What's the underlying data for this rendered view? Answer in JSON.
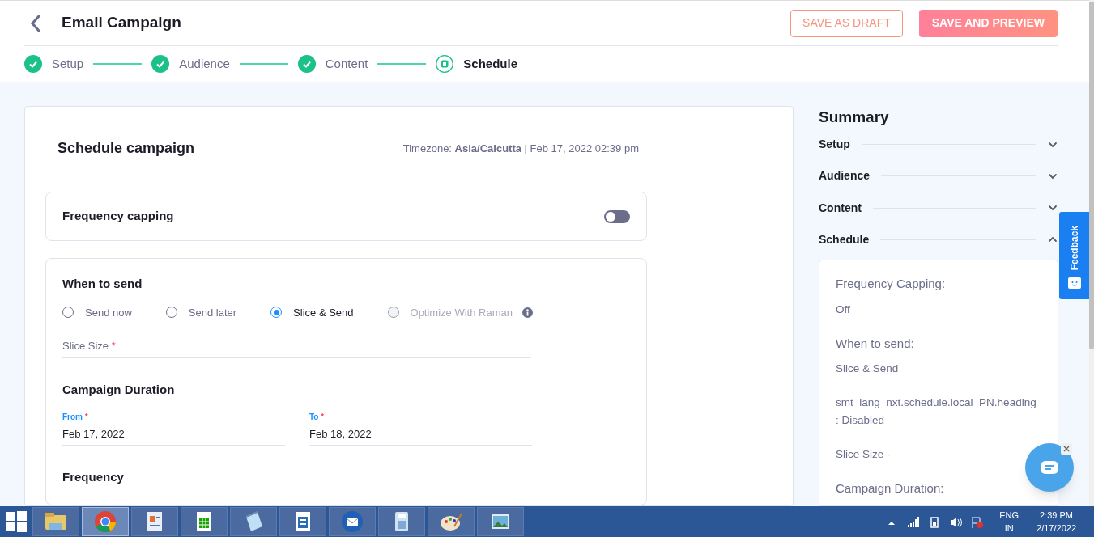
{
  "header": {
    "title": "Email Campaign",
    "buttons": [
      {
        "label": "SAVE AS DRAFT",
        "kind": "outline"
      },
      {
        "label": "SAVE AND PREVIEW",
        "kind": "filled"
      }
    ]
  },
  "steps": [
    {
      "label": "Setup",
      "completed": true
    },
    {
      "label": "Audience",
      "completed": true
    },
    {
      "label": "Content",
      "completed": true
    },
    {
      "label": "Schedule",
      "completed": false
    }
  ],
  "schedule": {
    "title": "Schedule campaign",
    "timezone_label": "Timezone:",
    "timezone": "Asia/Calcutta",
    "datetime": "| Feb 17, 2022 02:39 pm",
    "frequency_capping": {
      "label": "Frequency capping",
      "on": false
    },
    "when_to_send": {
      "title": "When to send",
      "options": [
        {
          "label": "Send now",
          "selected": false,
          "disabled": false
        },
        {
          "label": "Send later",
          "selected": false,
          "disabled": false
        },
        {
          "label": "Slice & Send",
          "selected": true,
          "disabled": false
        },
        {
          "label": "Optimize With Raman",
          "selected": false,
          "disabled": true
        }
      ]
    },
    "slice_size": {
      "placeholder": "Slice Size",
      "required_mark": "*"
    },
    "duration": {
      "title": "Campaign Duration",
      "fields": [
        {
          "label": "From",
          "value": "Feb 17, 2022",
          "required_mark": "*"
        },
        {
          "label": "To",
          "value": "Feb 18, 2022",
          "required_mark": "*"
        }
      ]
    },
    "frequency": {
      "title": "Frequency"
    }
  },
  "summary": {
    "title": "Summary",
    "sections": [
      {
        "label": "Setup",
        "expanded": false
      },
      {
        "label": "Audience",
        "expanded": false
      },
      {
        "label": "Content",
        "expanded": false
      },
      {
        "label": "Schedule",
        "expanded": true
      }
    ],
    "details": [
      {
        "kind": "heading",
        "text": "Frequency Capping:"
      },
      {
        "kind": "value",
        "text": "Off"
      },
      {
        "kind": "heading",
        "text": "When to send:"
      },
      {
        "kind": "value",
        "text": "Slice & Send"
      },
      {
        "kind": "value",
        "text": "smt_lang_nxt.schedule.local_PN.heading : Disabled"
      },
      {
        "kind": "value",
        "text": "Slice Size -"
      },
      {
        "kind": "heading",
        "text": "Campaign Duration:"
      }
    ]
  },
  "feedback": {
    "label": "Feedback"
  },
  "taskbar": {
    "apps": [
      {
        "kind": "folder",
        "active": false
      },
      {
        "kind": "chrome",
        "active": true
      },
      {
        "kind": "wordpad",
        "active": false
      },
      {
        "kind": "calc",
        "active": false
      },
      {
        "kind": "notepad",
        "active": false
      },
      {
        "kind": "writer",
        "active": false
      },
      {
        "kind": "mail",
        "active": false
      },
      {
        "kind": "calculator",
        "active": false
      },
      {
        "kind": "paint",
        "active": false
      },
      {
        "kind": "photos",
        "active": false
      }
    ],
    "lang": "ENG",
    "region": "IN",
    "time": "2:39 PM",
    "date": "2/17/2022"
  }
}
